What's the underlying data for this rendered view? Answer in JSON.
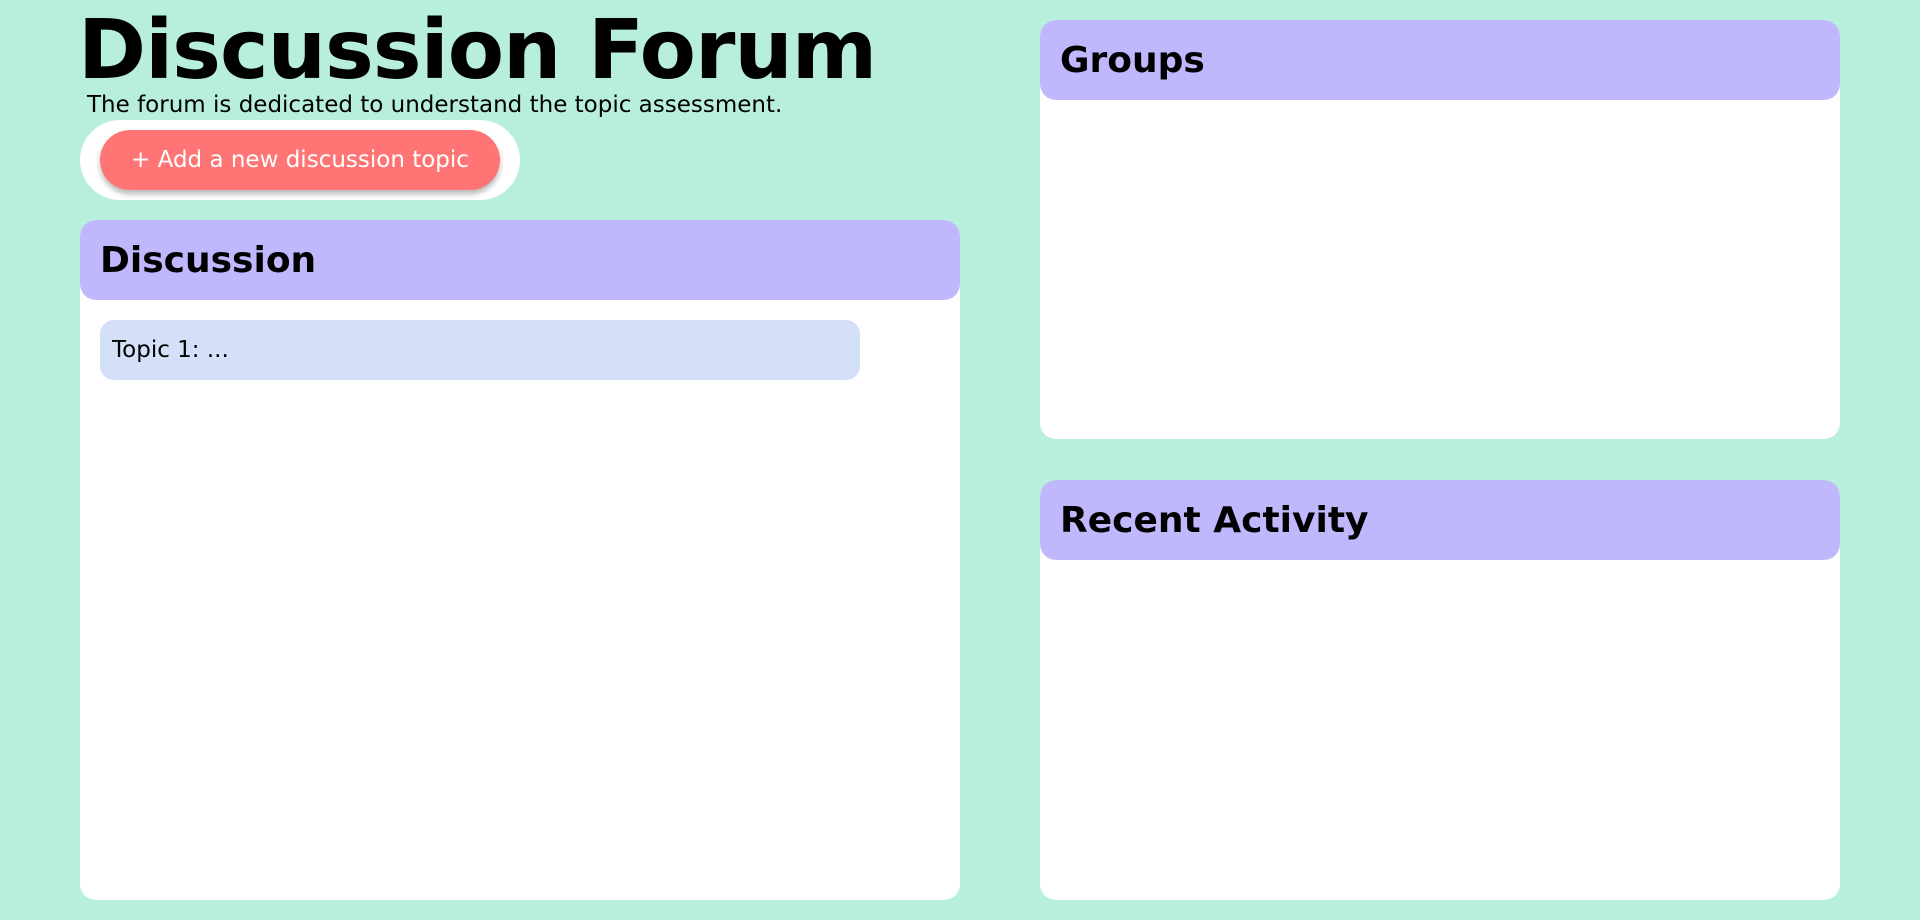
{
  "header": {
    "title": "Discussion Forum",
    "subtitle": "The forum is dedicated to understand the topic assessment."
  },
  "actions": {
    "add_topic_label": "+ Add a new discussion topic"
  },
  "discussion": {
    "heading": "Discussion",
    "topics": [
      {
        "label": "Topic 1: ..."
      }
    ]
  },
  "groups": {
    "heading": "Groups"
  },
  "recent_activity": {
    "heading": "Recent Activity"
  },
  "colors": {
    "background": "#b8eedc",
    "panel_header": "#c0b8fd",
    "panel_body": "#ffffff",
    "add_button": "#ff7474",
    "topic_item": "#d3e0f8"
  }
}
